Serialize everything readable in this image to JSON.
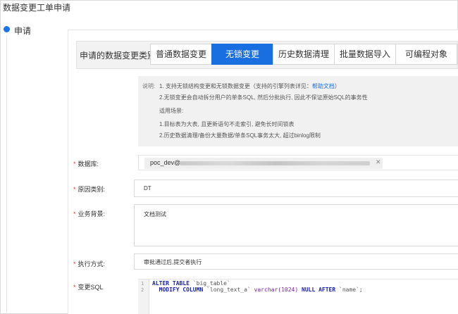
{
  "page_title": "数据变更工单申请",
  "step": {
    "label": "申请"
  },
  "change_type": {
    "label": "申请的数据变更类别:",
    "tabs": [
      {
        "label": "普通数据变更",
        "active": false
      },
      {
        "label": "无锁变更",
        "active": true
      },
      {
        "label": "历史数据清理",
        "active": false
      },
      {
        "label": "批量数据导入",
        "active": false
      },
      {
        "label": "可编程对象",
        "active": false
      }
    ]
  },
  "note": {
    "prefix": "说明:",
    "line1": "1. 支持无锁结构变更和无锁数据变更（支持的引擎列表详见：",
    "line1_link": "帮助文档",
    "line1_end": "）",
    "line2": "2.无锁变更会自动拆分用户的单条SQL, 然后分批执行, 因此不保证原始SQL的事务性",
    "heading": "适用场景:",
    "line3": "1.目标表为大表, 且更新语句不走索引, 避免长时间锁表",
    "line4": "2.历史数据清理/备份大量数据/单条SQL事务太大, 超过binlog限制"
  },
  "fields": {
    "database": {
      "label": "数据库:",
      "value": "poc_dev@"
    },
    "reason": {
      "label": "原因类别:",
      "value": "DT"
    },
    "background": {
      "label": "业务背景:",
      "value": "文档测试"
    },
    "exec_mode": {
      "label": "执行方式:",
      "value": "审批通过后,提交者执行"
    },
    "sql": {
      "label": "变更SQL",
      "line_numbers": [
        "1",
        "2"
      ],
      "line1": {
        "kw1": "ALTER TABLE",
        "ident": "`big_table`"
      },
      "line2": {
        "kw1": "MODIFY COLUMN",
        "ident": "`long_text_a`",
        "type": "varchar(1024)",
        "kw2": "NULL",
        "kw3": "AFTER",
        "ident2": "`name`",
        "end": ";"
      }
    }
  }
}
